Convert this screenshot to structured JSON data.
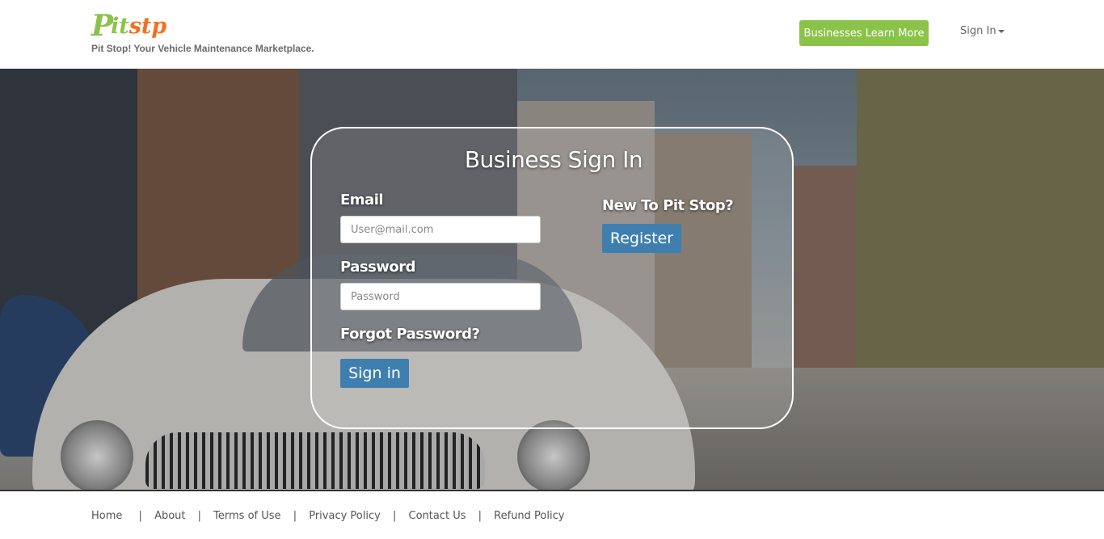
{
  "header": {
    "logo_p": "P",
    "logo_it": "it",
    "logo_stp": "stp",
    "tagline": "Pit Stop! Your Vehicle Maintenance Marketplace.",
    "learn_more_label": "Businesses Learn More",
    "signin_label": "Sign In"
  },
  "signin_panel": {
    "title": "Business Sign In",
    "email_label": "Email",
    "email_placeholder": "User@mail.com",
    "password_label": "Password",
    "password_placeholder": "Password",
    "forgot_label": "Forgot Password?",
    "signin_button": "Sign in",
    "new_label": "New To Pit Stop?",
    "register_button": "Register"
  },
  "footer": {
    "links": [
      "Home",
      "About",
      "Terms of Use",
      "Privacy Policy",
      "Contact Us",
      "Refund Policy"
    ],
    "separator": "|"
  },
  "colors": {
    "brand_green": "#8bc34a",
    "brand_orange": "#f36f21",
    "button_blue": "#3f7fb0"
  }
}
